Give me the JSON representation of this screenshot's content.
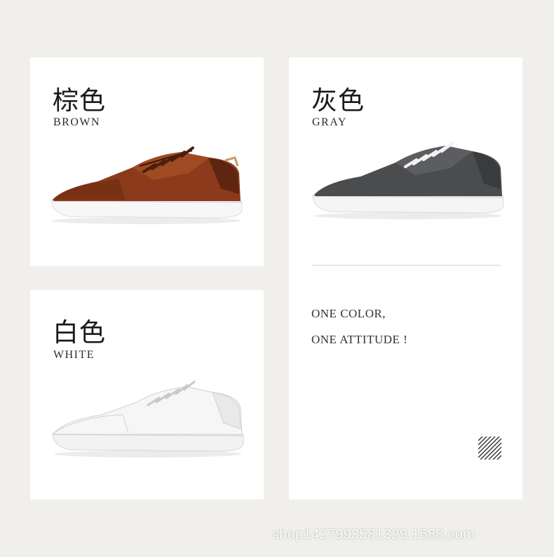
{
  "cards": {
    "brown": {
      "cn": "棕色",
      "en": "BROWN"
    },
    "gray": {
      "cn": "灰色",
      "en": "GRAY"
    },
    "white": {
      "cn": "白色",
      "en": "WHITE"
    }
  },
  "slogan": {
    "line1": "ONE COLOR,",
    "line2": "ONE ATTITUDE !"
  },
  "watermark": "shop1427993581329.1688.com",
  "colors": {
    "background": "#f0efec",
    "brown_leather": "#8a3a1c",
    "gray_leather": "#4a4b4d",
    "white_leather": "#f4f4f4"
  },
  "icons": [
    "brown-sneaker-image",
    "gray-sneaker-image",
    "white-sneaker-image",
    "diagonal-hatch-icon"
  ]
}
